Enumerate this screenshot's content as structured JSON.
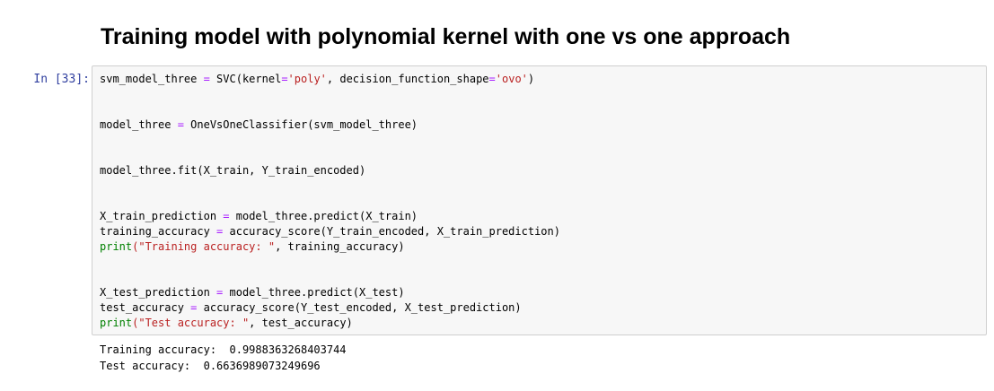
{
  "heading": "Training model with polynomial kernel with one vs one approach",
  "cell": {
    "prompt": "In [33]:",
    "code_lines": [
      [
        {
          "t": "svm_model_three "
        },
        {
          "t": "=",
          "c": "op"
        },
        {
          "t": " SVC(kernel"
        },
        {
          "t": "=",
          "c": "op"
        },
        {
          "t": "'poly'",
          "c": "str"
        },
        {
          "t": ", decision_function_shape"
        },
        {
          "t": "=",
          "c": "op"
        },
        {
          "t": "'ovo'",
          "c": "str"
        },
        {
          "t": ")"
        }
      ],
      [],
      [],
      [
        {
          "t": "model_three "
        },
        {
          "t": "=",
          "c": "op"
        },
        {
          "t": " OneVsOneClassifier(svm_model_three)"
        }
      ],
      [],
      [],
      [
        {
          "t": "model_three.fit(X_train, Y_train_encoded)"
        }
      ],
      [],
      [],
      [
        {
          "t": "X_train_prediction "
        },
        {
          "t": "=",
          "c": "op"
        },
        {
          "t": " model_three.predict(X_train)"
        }
      ],
      [
        {
          "t": "training_accuracy "
        },
        {
          "t": "=",
          "c": "op"
        },
        {
          "t": " accuracy_score(Y_train_encoded, X_train_prediction)"
        }
      ],
      [
        {
          "t": "print",
          "c": "builtin"
        },
        {
          "t": "(\"Training accuracy: \"",
          "c": "str"
        },
        {
          "t": ", training_accuracy)"
        }
      ],
      [],
      [],
      [
        {
          "t": "X_test_prediction "
        },
        {
          "t": "=",
          "c": "op"
        },
        {
          "t": " model_three.predict(X_test)"
        }
      ],
      [
        {
          "t": "test_accuracy "
        },
        {
          "t": "=",
          "c": "op"
        },
        {
          "t": " accuracy_score(Y_test_encoded, X_test_prediction)"
        }
      ],
      [
        {
          "t": "print",
          "c": "builtin"
        },
        {
          "t": "(\"Test accuracy: \"",
          "c": "str"
        },
        {
          "t": ", test_accuracy)"
        }
      ]
    ],
    "output_lines": [
      "Training accuracy:  0.9988363268403744",
      "Test accuracy:  0.6636989073249696"
    ]
  },
  "colors": {
    "prompt": "#303f9f",
    "operator": "#aa22ff",
    "string": "#ba2121",
    "builtin": "#008000",
    "cell_background": "#f7f7f7",
    "cell_border": "#cfcfcf"
  }
}
